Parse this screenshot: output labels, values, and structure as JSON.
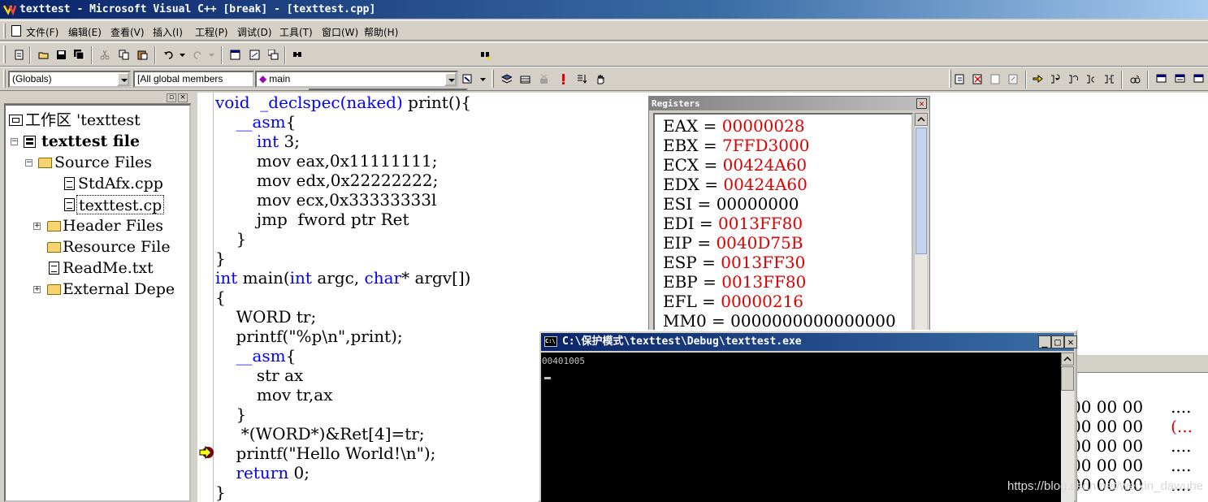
{
  "app": {
    "title": "texttest - Microsoft Visual C++ [break] - [texttest.cpp]"
  },
  "menu": [
    "文件(F)",
    "编辑(E)",
    "查看(V)",
    "插入(I)",
    "工程(P)",
    "调试(D)",
    "工具(T)",
    "窗口(W)",
    "帮助(H)"
  ],
  "wizard": {
    "scope": "(Globals)",
    "filter": "[All global members",
    "member": "main"
  },
  "workspace": {
    "items": [
      {
        "label": "工作区 'texttest",
        "icon": "workspace-icon"
      },
      {
        "label": "texttest file",
        "icon": "project-icon"
      },
      {
        "label": "Source Files",
        "icon": "folder-icon"
      },
      {
        "label": "StdAfx.cpp",
        "icon": "file-icon"
      },
      {
        "label": "texttest.cp",
        "icon": "file-icon"
      },
      {
        "label": "Header Files",
        "icon": "folder-icon"
      },
      {
        "label": "Resource File",
        "icon": "folder-icon"
      },
      {
        "label": "ReadMe.txt",
        "icon": "file-icon"
      },
      {
        "label": "External Depe",
        "icon": "folder-icon"
      }
    ]
  },
  "code": {
    "lines": [
      {
        "pre": "",
        "kw": "void",
        "rest": "  _declspec(naked) print(){",
        "kwcolor": "blue"
      },
      {
        "pre": "    ",
        "kw": "__asm",
        "rest": "{"
      },
      {
        "pre": "        ",
        "kw": "int",
        "rest": " 3;"
      },
      {
        "pre": "        ",
        "kw": "",
        "rest": "mov eax,0x11111111;"
      },
      {
        "pre": "        ",
        "kw": "",
        "rest": "mov edx,0x22222222;"
      },
      {
        "pre": "        ",
        "kw": "",
        "rest": "mov ecx,0x33333333l"
      },
      {
        "pre": "        ",
        "kw": "",
        "rest": "jmp  fword ptr Ret"
      },
      {
        "pre": "    ",
        "kw": "",
        "rest": "}"
      },
      {
        "pre": "",
        "kw": "",
        "rest": "}"
      },
      {
        "pre": "",
        "kw": "int",
        "rest": " main(int argc, char* argv[])"
      },
      {
        "pre": "",
        "kw": "",
        "rest": "{"
      },
      {
        "pre": "    ",
        "kw": "",
        "rest": "WORD tr;"
      },
      {
        "pre": "    ",
        "kw": "",
        "rest": "printf(\"%p\\n\",print);"
      },
      {
        "pre": "    ",
        "kw": "__asm",
        "rest": "{"
      },
      {
        "pre": "        ",
        "kw": "",
        "rest": "str ax"
      },
      {
        "pre": "        ",
        "kw": "",
        "rest": "mov tr,ax"
      },
      {
        "pre": "    ",
        "kw": "",
        "rest": "}"
      },
      {
        "pre": "     ",
        "kw": "",
        "rest": "*(WORD*)&Ret[4]=tr;"
      },
      {
        "pre": "    ",
        "kw": "",
        "rest": "printf(\"Hello World!\\n\");"
      },
      {
        "pre": "    ",
        "kw": "return",
        "rest": " 0;"
      },
      {
        "pre": "",
        "kw": "",
        "rest": "}"
      }
    ],
    "inline_keywords": {
      "9": [
        "int",
        "char"
      ]
    }
  },
  "registers": {
    "title": "Registers",
    "rows": [
      {
        "name": "EAX",
        "value": "00000028",
        "changed": true
      },
      {
        "name": "EBX",
        "value": "7FFD3000",
        "changed": true
      },
      {
        "name": "ECX",
        "value": "00424A60",
        "changed": true
      },
      {
        "name": "EDX",
        "value": "00424A60",
        "changed": true
      },
      {
        "name": "ESI",
        "value": "00000000",
        "changed": false
      },
      {
        "name": "EDI",
        "value": "0013FF80",
        "changed": true
      },
      {
        "name": "EIP",
        "value": "0040D75B",
        "changed": true
      },
      {
        "name": "ESP",
        "value": "0013FF30",
        "changed": true
      },
      {
        "name": "EBP",
        "value": "0013FF80",
        "changed": true
      },
      {
        "name": "EFL",
        "value": "00000216",
        "changed": true
      },
      {
        "name": "MM0",
        "value": "0000000000000000",
        "changed": false
      }
    ]
  },
  "memory": {
    "rows": [
      {
        "hex": "00 00 00",
        "ascii": "...."
      },
      {
        "hex": "00 00 00",
        "ascii": "(..."
      },
      {
        "hex": "00 00 00",
        "ascii": "...."
      },
      {
        "hex": "00 00 00",
        "ascii": "...."
      },
      {
        "hex": "00 00 00",
        "ascii": "...."
      }
    ]
  },
  "console": {
    "title": "C:\\保护模式\\texttest\\Debug\\texttest.exe",
    "output": "00401005",
    "icon_text": "C:\\"
  },
  "watermark": "https://blog.csdn.net/weixin_dawuhe"
}
